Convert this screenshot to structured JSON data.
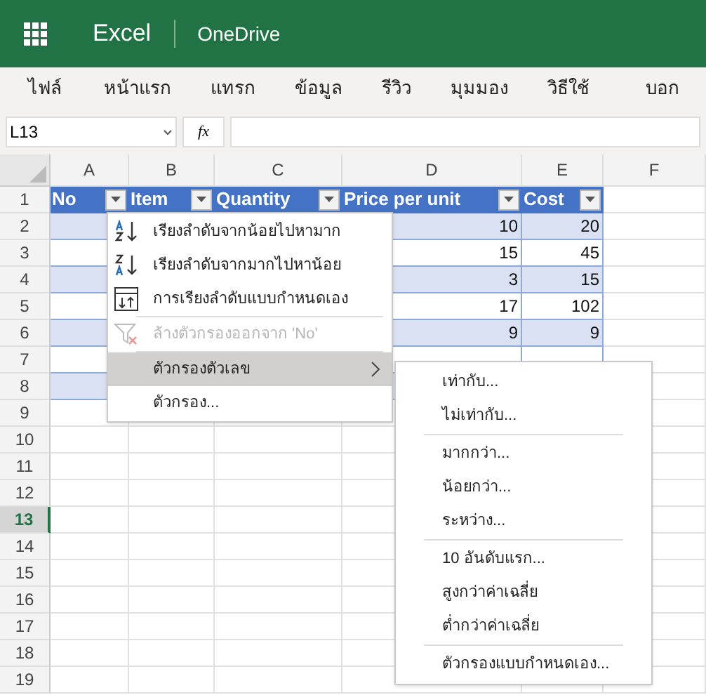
{
  "app_bar": {
    "app_name": "Excel",
    "location": "OneDrive"
  },
  "ribbon_tabs": [
    {
      "label": "ไฟล์",
      "selected": false
    },
    {
      "label": "หน้าแรก",
      "selected": false
    },
    {
      "label": "แทรก",
      "selected": false
    },
    {
      "label": "ข้อมูล",
      "selected": false
    },
    {
      "label": "รีวิว",
      "selected": false
    },
    {
      "label": "มุมมอง",
      "selected": false
    },
    {
      "label": "วิธีใช้",
      "selected": false
    },
    {
      "label": "บอก",
      "selected": false
    }
  ],
  "formula_bar": {
    "name_box": "L13",
    "fx": "fx"
  },
  "grid": {
    "columns": [
      "A",
      "B",
      "C",
      "D",
      "E",
      "F"
    ],
    "rows": [
      {
        "header": "1",
        "selected": false,
        "cells": [
          "No",
          "Item",
          "Quantity",
          "Price per unit",
          "Cost",
          ""
        ]
      },
      {
        "header": "2",
        "selected": false,
        "cells": [
          "",
          "",
          "",
          "10",
          "20",
          ""
        ]
      },
      {
        "header": "3",
        "selected": false,
        "cells": [
          "",
          "",
          "",
          "15",
          "45",
          ""
        ]
      },
      {
        "header": "4",
        "selected": false,
        "cells": [
          "",
          "",
          "",
          "3",
          "15",
          ""
        ]
      },
      {
        "header": "5",
        "selected": false,
        "cells": [
          "",
          "",
          "",
          "17",
          "102",
          ""
        ]
      },
      {
        "header": "6",
        "selected": false,
        "cells": [
          "",
          "",
          "",
          "9",
          "9",
          ""
        ]
      },
      {
        "header": "7",
        "selected": false,
        "cells": [
          "",
          "",
          "",
          "",
          "",
          ""
        ]
      },
      {
        "header": "8",
        "selected": false,
        "cells": [
          "",
          "",
          "",
          "",
          "",
          ""
        ]
      },
      {
        "header": "9",
        "selected": false,
        "cells": []
      },
      {
        "header": "10",
        "selected": false,
        "cells": []
      },
      {
        "header": "11",
        "selected": false,
        "cells": []
      },
      {
        "header": "12",
        "selected": false,
        "cells": []
      },
      {
        "header": "13",
        "selected": true,
        "cells": []
      },
      {
        "header": "14",
        "selected": false,
        "cells": []
      },
      {
        "header": "15",
        "selected": false,
        "cells": []
      },
      {
        "header": "16",
        "selected": false,
        "cells": []
      },
      {
        "header": "17",
        "selected": false,
        "cells": []
      },
      {
        "header": "18",
        "selected": false,
        "cells": []
      },
      {
        "header": "19",
        "selected": false,
        "cells": []
      }
    ]
  },
  "filter_menu": {
    "items": [
      {
        "kind": "sort_asc",
        "label": "เรียงลำดับจากน้อยไปหามาก",
        "disabled": false,
        "highlighted": false
      },
      {
        "kind": "sort_desc",
        "label": "เรียงลำดับจากมากไปหาน้อย",
        "disabled": false,
        "highlighted": false
      },
      {
        "kind": "custom_sort",
        "label": "การเรียงลำดับแบบกำหนดเอง",
        "disabled": false,
        "highlighted": false
      },
      {
        "kind": "clear",
        "label": "ล้างตัวกรองออกจาก 'No'",
        "disabled": true,
        "highlighted": false
      },
      {
        "kind": "submenu",
        "label": "ตัวกรองตัวเลข",
        "disabled": false,
        "highlighted": true
      },
      {
        "kind": "plain",
        "label": "ตัวกรอง...",
        "disabled": false,
        "highlighted": false
      }
    ]
  },
  "number_filters_submenu": {
    "groups": [
      [
        "เท่ากับ...",
        "ไม่เท่ากับ..."
      ],
      [
        "มากกว่า...",
        "น้อยกว่า...",
        "ระหว่าง..."
      ],
      [
        "10 อันดับแรก...",
        "สูงกว่าค่าเฉลี่ย",
        "ต่ำกว่าค่าเฉลี่ย"
      ],
      [
        "ตัวกรองแบบกำหนดเอง..."
      ]
    ]
  }
}
